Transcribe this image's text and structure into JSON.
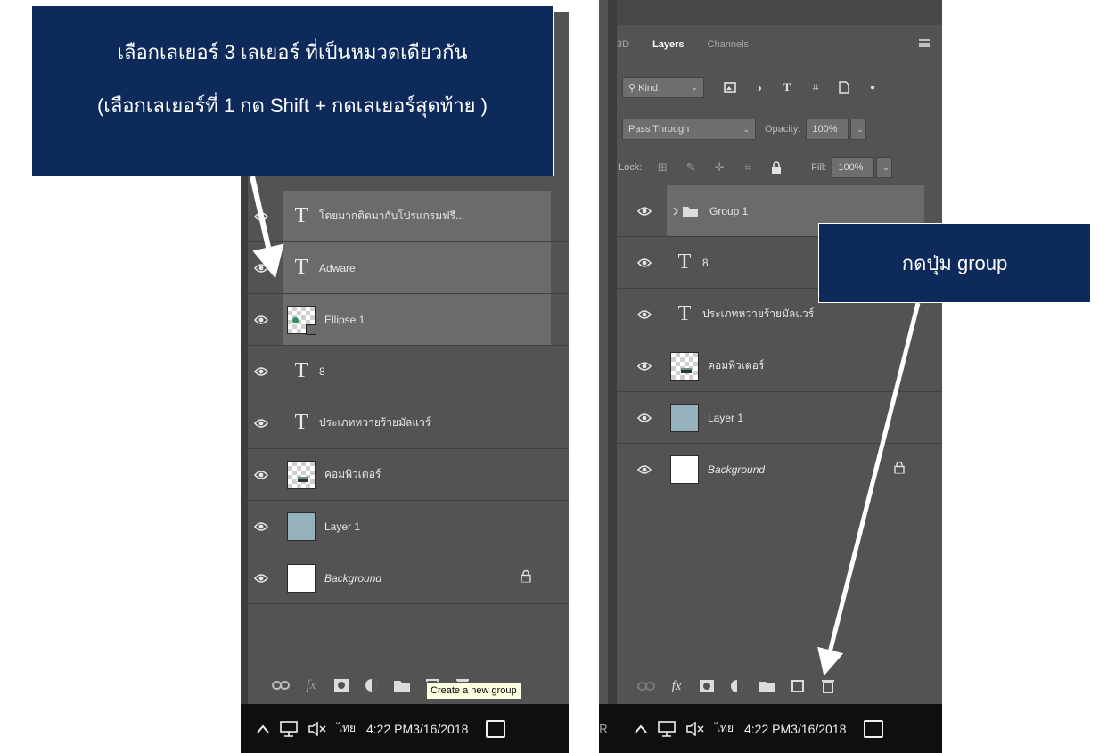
{
  "callouts": {
    "left_line1": "เลือกเลเยอร์ 3 เลเยอร์ ที่เป็นหมวดเดียวกัน",
    "left_line2": "(เลือกเลเยอร์ที่ 1 กด Shift + กดเลเยอร์สุดท้าย )",
    "right": "กดปุ่ม group"
  },
  "left_panel": {
    "layers": [
      {
        "kind": "text",
        "glyph": "T",
        "name": "โดยมากติดมากับโปรแกรมฟรี...",
        "selected": true
      },
      {
        "kind": "text",
        "glyph": "T",
        "name": "Adware",
        "selected": true
      },
      {
        "kind": "shape",
        "name": "Ellipse 1",
        "selected": true
      },
      {
        "kind": "text",
        "glyph": "T",
        "name": "8",
        "selected": false
      },
      {
        "kind": "text",
        "glyph": "T",
        "name": "ประเภทหวายร้ายมัลแวร์",
        "selected": false
      },
      {
        "kind": "image",
        "name": "คอมพิวเตอร์",
        "selected": false
      },
      {
        "kind": "fill",
        "name": "Layer 1",
        "selected": false
      },
      {
        "kind": "background",
        "name": "Background",
        "selected": false
      }
    ],
    "tooltip": "Create a new group",
    "bottom_icons": [
      "link-icon",
      "fx-icon",
      "mask-icon",
      "adjustment-icon",
      "group-icon",
      "new-layer-icon",
      "trash-icon"
    ]
  },
  "right_panel": {
    "tabs": [
      "3D",
      "Layers",
      "Channels"
    ],
    "active_tab": "Layers",
    "filter_label": "Kind",
    "blend_mode": "Pass Through",
    "opacity_label": "Opacity:",
    "opacity_value": "100%",
    "lock_label": "Lock:",
    "fill_label": "Fill:",
    "fill_value": "100%",
    "layers": [
      {
        "kind": "group",
        "name": "Group 1",
        "selected": true
      },
      {
        "kind": "text",
        "glyph": "T",
        "name": "8",
        "selected": false
      },
      {
        "kind": "text",
        "glyph": "T",
        "name": "ประเภทหวายร้ายมัลแวร์",
        "selected": false
      },
      {
        "kind": "image",
        "name": "คอมพิวเตอร์",
        "selected": false
      },
      {
        "kind": "fill",
        "name": "Layer 1",
        "selected": false
      },
      {
        "kind": "background",
        "name": "Background",
        "selected": false
      }
    ],
    "taskbar_prefix": "R"
  },
  "taskbar": {
    "lang": "ไทย",
    "time": "4:22 PM",
    "date": "3/16/2018"
  },
  "colors": {
    "callout_bg": "#0d2a5b",
    "panel_bg": "#535353",
    "selected_row": "#6b6b6b",
    "layer1_fill": "#95b1bb"
  }
}
